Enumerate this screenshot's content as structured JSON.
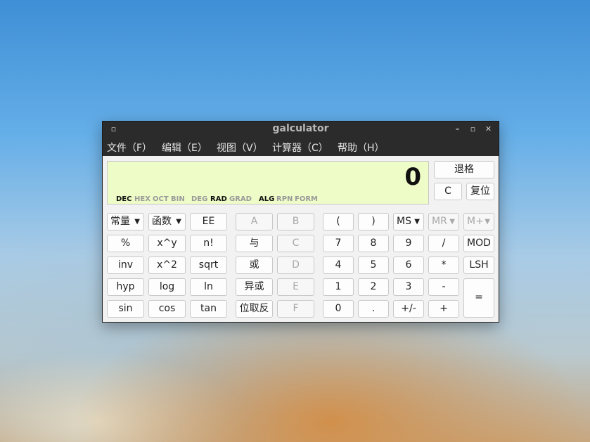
{
  "window": {
    "title": "galculator"
  },
  "menu": [
    "文件（F）",
    "编辑（E）",
    "视图（V）",
    "计算器（C）",
    "帮助（H）"
  ],
  "display": {
    "value": "0",
    "number_modes": [
      "DEC",
      "HEX",
      "OCT",
      "BIN"
    ],
    "angle_modes": [
      "DEG",
      "RAD",
      "GRAD"
    ],
    "entry_modes": [
      "ALG",
      "RPN",
      "FORM"
    ],
    "active": [
      "DEC",
      "RAD",
      "ALG"
    ]
  },
  "side_buttons": {
    "backspace": "退格",
    "clear": "C",
    "reset": "复位"
  },
  "func": {
    "constants": "常量",
    "functions": "函数",
    "ee": "EE",
    "percent": "%",
    "xpowy": "x^y",
    "fact": "n!",
    "inv": "inv",
    "xsq": "x^2",
    "sqrt": "sqrt",
    "hyp": "hyp",
    "log": "log",
    "ln": "ln",
    "sin": "sin",
    "cos": "cos",
    "tan": "tan"
  },
  "logic": {
    "a": "A",
    "b": "B",
    "and": "与",
    "c": "C",
    "or": "或",
    "d": "D",
    "xor": "异或",
    "e": "E",
    "not": "位取反",
    "f": "F"
  },
  "num": {
    "lparen": "(",
    "rparen": ")",
    "n7": "7",
    "n8": "8",
    "n9": "9",
    "n4": "4",
    "n5": "5",
    "n6": "6",
    "n1": "1",
    "n2": "2",
    "n3": "3",
    "n0": "0",
    "dot": ".",
    "sign": "+/-"
  },
  "ops": {
    "ms": "MS",
    "mr": "MR",
    "mplus": "M+",
    "div": "/",
    "mod": "MOD",
    "mul": "*",
    "lsh": "LSH",
    "sub": "-",
    "add": "+",
    "eq": "="
  }
}
